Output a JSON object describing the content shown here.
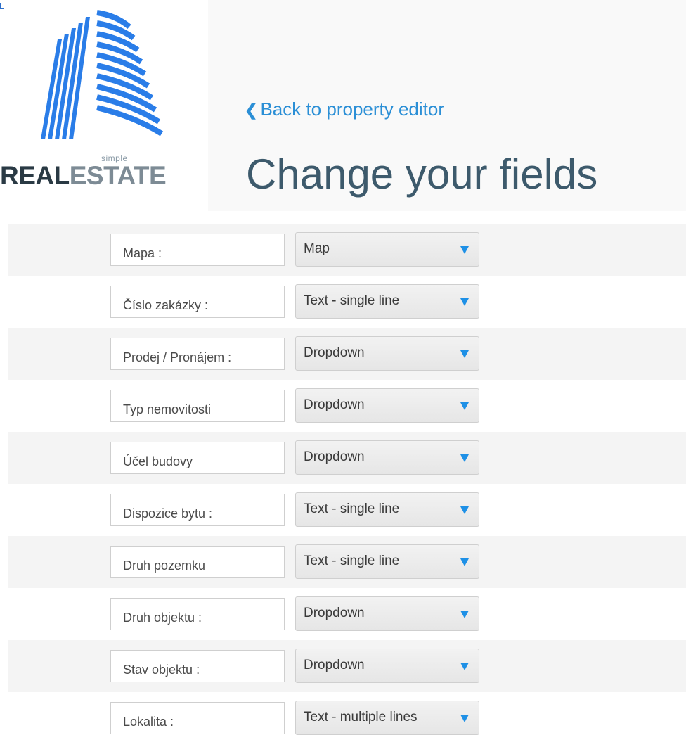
{
  "logo": {
    "small_text": "simple",
    "word_real": "REAL",
    "word_estate": "ESTATE"
  },
  "nav": {
    "back_label": "Back to property editor"
  },
  "page": {
    "title": "Change your fields"
  },
  "fields": [
    {
      "name": "Mapa :",
      "type": "Map"
    },
    {
      "name": "Číslo zakázky :",
      "type": "Text - single line"
    },
    {
      "name": "Prodej / Pronájem :",
      "type": "Dropdown"
    },
    {
      "name": "Typ nemovitosti",
      "type": "Dropdown"
    },
    {
      "name": "Účel budovy",
      "type": "Dropdown"
    },
    {
      "name": "Dispozice bytu :",
      "type": "Text - single line"
    },
    {
      "name": "Druh pozemku",
      "type": "Text - single line"
    },
    {
      "name": "Druh objektu :",
      "type": "Dropdown"
    },
    {
      "name": "Stav objektu :",
      "type": "Dropdown"
    },
    {
      "name": "Lokalita :",
      "type": "Text - multiple lines"
    }
  ],
  "colors": {
    "accent": "#2b8fd6",
    "arrow": "#1e90e6",
    "title": "#3d5a6c"
  },
  "icons": {
    "back": "chevron-left-icon",
    "dropdown": "triangle-down-icon"
  }
}
